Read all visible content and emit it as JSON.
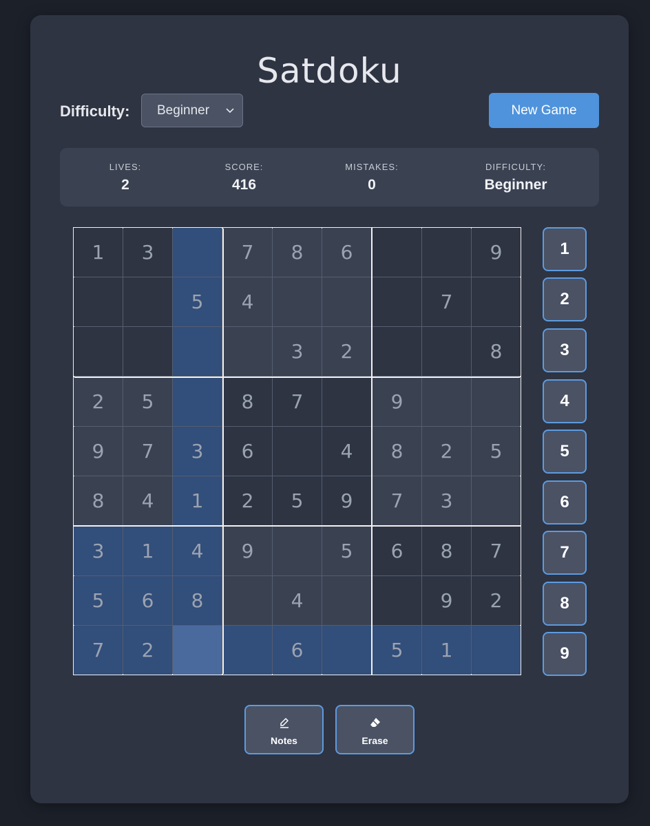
{
  "app": {
    "title": "Satdoku"
  },
  "controls": {
    "difficulty_label": "Difficulty:",
    "difficulty_selected": "Beginner",
    "new_game_label": "New Game"
  },
  "stats": [
    {
      "label": "LIVES:",
      "value": "2"
    },
    {
      "label": "SCORE:",
      "value": "416"
    },
    {
      "label": "MISTAKES:",
      "value": "0"
    },
    {
      "label": "DIFFICULTY:",
      "value": "Beginner"
    }
  ],
  "board": {
    "grid": [
      [
        1,
        3,
        0,
        7,
        8,
        6,
        0,
        0,
        9
      ],
      [
        0,
        0,
        5,
        4,
        0,
        0,
        0,
        7,
        0
      ],
      [
        0,
        0,
        0,
        0,
        3,
        2,
        0,
        0,
        8
      ],
      [
        2,
        5,
        0,
        8,
        7,
        0,
        9,
        0,
        0
      ],
      [
        9,
        7,
        3,
        6,
        0,
        4,
        8,
        2,
        5
      ],
      [
        8,
        4,
        1,
        2,
        5,
        9,
        7,
        3,
        0
      ],
      [
        3,
        1,
        4,
        9,
        0,
        5,
        6,
        8,
        7
      ],
      [
        5,
        6,
        8,
        0,
        4,
        0,
        0,
        9,
        2
      ],
      [
        7,
        2,
        0,
        0,
        6,
        0,
        5,
        1,
        0
      ]
    ],
    "selected": {
      "row": 8,
      "col": 2
    }
  },
  "number_pad": [
    "1",
    "2",
    "3",
    "4",
    "5",
    "6",
    "7",
    "8",
    "9"
  ],
  "tools": [
    {
      "label": "Notes",
      "icon": "pencil-icon"
    },
    {
      "label": "Erase",
      "icon": "eraser-icon"
    }
  ],
  "colors": {
    "accent": "#4f93dc",
    "highlight": "#324e7a",
    "selected_cell": "#4a6a9e",
    "panel": "#2e3442"
  }
}
